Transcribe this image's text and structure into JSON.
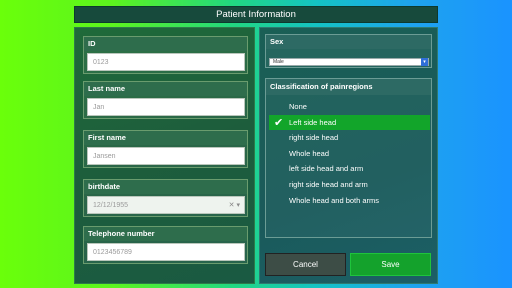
{
  "title": "Patient Information",
  "fields": [
    {
      "label": "ID",
      "value": "0123"
    },
    {
      "label": "Last name",
      "value": "Jan"
    },
    {
      "label": "First name",
      "value": "Jansen"
    },
    {
      "label": "birthdate",
      "value": "12/12/1955"
    },
    {
      "label": "Telephone number",
      "value": "0123456789"
    }
  ],
  "sex": {
    "label": "Sex",
    "value": "Male"
  },
  "classification": {
    "label": "Classification of painregions",
    "items": [
      "None",
      "Left side head",
      "right side head",
      "Whole head",
      "left side head and arm",
      "right side head and arm",
      "Whole head and both arms"
    ],
    "selected_index": 1
  },
  "buttons": {
    "cancel": "Cancel",
    "save": "Save"
  },
  "icons": {
    "date_stepper": "spin-arrows-icon",
    "select_arrow": "chevron-down-icon",
    "check": "checkmark-icon"
  },
  "colors": {
    "selected": "#12a52a",
    "save": "#14a22c",
    "cancel": "#3d4d46"
  }
}
